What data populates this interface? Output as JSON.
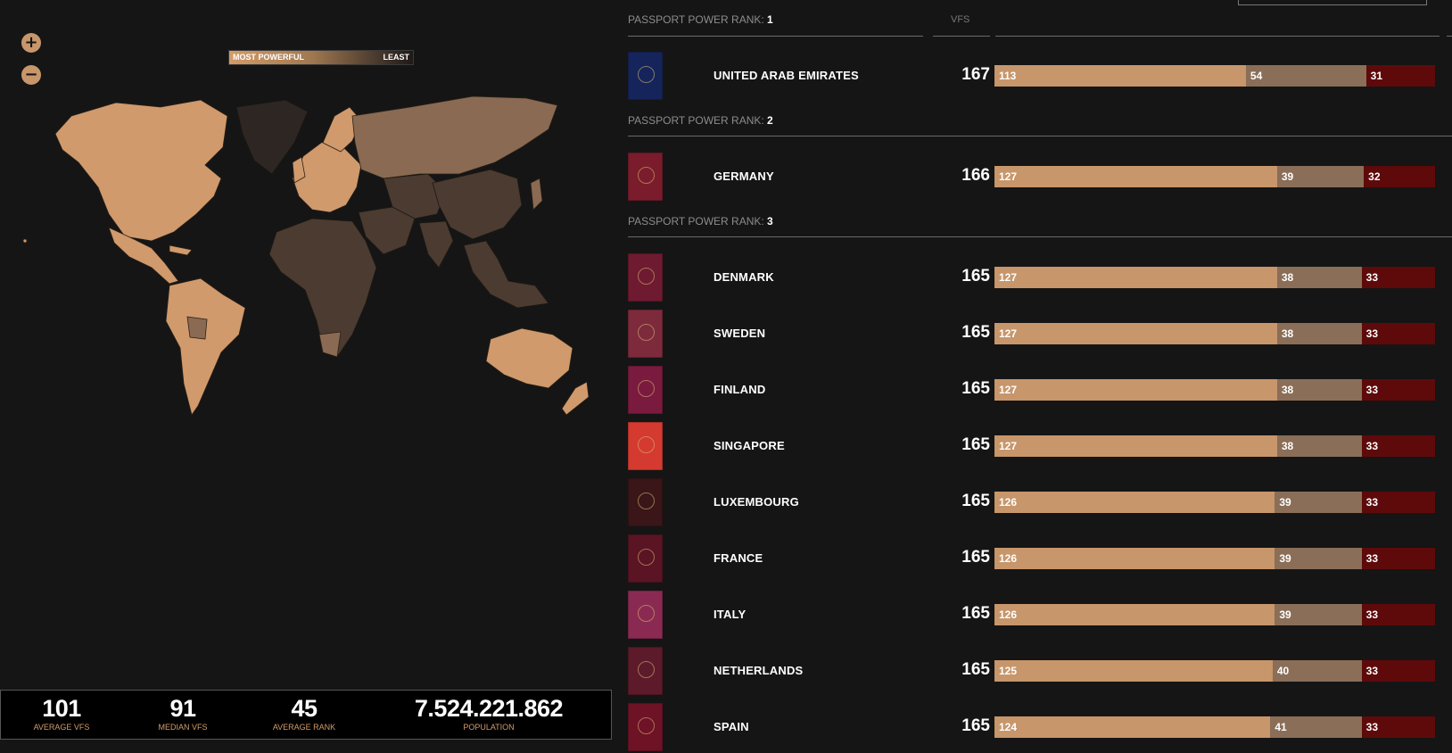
{
  "map": {
    "zoom_in": "+",
    "zoom_out": "−",
    "legend": {
      "most": "MOST POWERFUL",
      "least": "LEAST"
    }
  },
  "stats": {
    "average_vfs": {
      "value": "101",
      "label": "AVERAGE VFS"
    },
    "median_vfs": {
      "value": "91",
      "label": "MEDIAN VFS"
    },
    "average_rank": {
      "value": "45",
      "label": "AVERAGE RANK"
    },
    "population": {
      "value": "7.524.221.862",
      "label": "POPULATION"
    }
  },
  "list": {
    "rank_prefix": "PASSPORT POWER RANK:",
    "vfs_header": "VFS",
    "groups": [
      {
        "rank": "1",
        "rows": [
          {
            "country": "UNITED ARAB EMIRATES",
            "vfs": "167",
            "free": 113,
            "voa": 54,
            "req": 31,
            "color": "#15245a"
          }
        ]
      },
      {
        "rank": "2",
        "rows": [
          {
            "country": "GERMANY",
            "vfs": "166",
            "free": 127,
            "voa": 39,
            "req": 32,
            "color": "#7a1c2c"
          }
        ]
      },
      {
        "rank": "3",
        "rows": [
          {
            "country": "DENMARK",
            "vfs": "165",
            "free": 127,
            "voa": 38,
            "req": 33,
            "color": "#6e1a30"
          },
          {
            "country": "SWEDEN",
            "vfs": "165",
            "free": 127,
            "voa": 38,
            "req": 33,
            "color": "#7c2a3c"
          },
          {
            "country": "FINLAND",
            "vfs": "165",
            "free": 127,
            "voa": 38,
            "req": 33,
            "color": "#7a1a3e"
          },
          {
            "country": "SINGAPORE",
            "vfs": "165",
            "free": 127,
            "voa": 38,
            "req": 33,
            "color": "#d43a30"
          },
          {
            "country": "LUXEMBOURG",
            "vfs": "165",
            "free": 126,
            "voa": 39,
            "req": 33,
            "color": "#3a1618"
          },
          {
            "country": "FRANCE",
            "vfs": "165",
            "free": 126,
            "voa": 39,
            "req": 33,
            "color": "#5a1424"
          },
          {
            "country": "ITALY",
            "vfs": "165",
            "free": 126,
            "voa": 39,
            "req": 33,
            "color": "#8a2a52"
          },
          {
            "country": "NETHERLANDS",
            "vfs": "165",
            "free": 125,
            "voa": 40,
            "req": 33,
            "color": "#5c1a2a"
          },
          {
            "country": "SPAIN",
            "vfs": "165",
            "free": 124,
            "voa": 41,
            "req": 33,
            "color": "#6e1226"
          }
        ]
      }
    ]
  }
}
